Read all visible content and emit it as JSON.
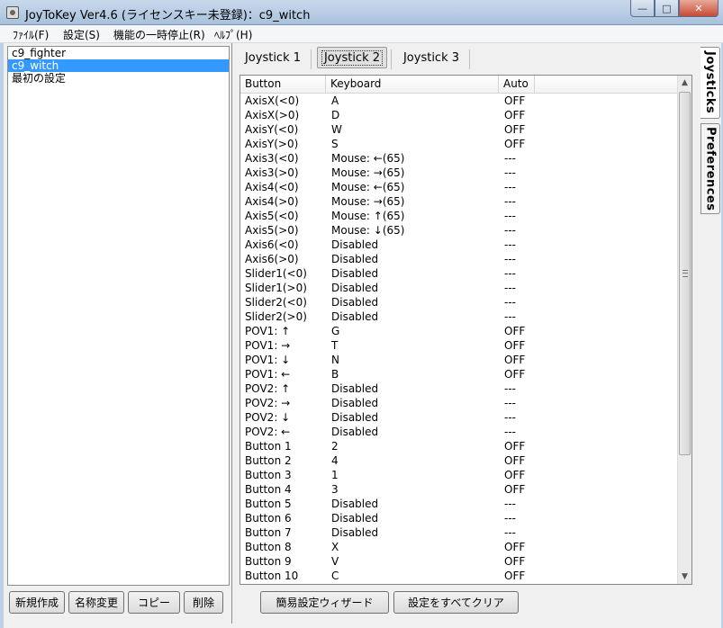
{
  "window": {
    "title": "JoyToKey Ver4.6 (ライセンスキー未登録)：c9_witch",
    "minimize": "—",
    "maximize": "□",
    "close": "✕"
  },
  "menu": [
    "ﾌｧｲﾙ(F)",
    "設定(S)",
    "機能の一時停止(R)",
    "ﾍﾙﾌﾟ(H)"
  ],
  "profiles": [
    {
      "label": "c9_fighter",
      "selected": false
    },
    {
      "label": "c9_witch",
      "selected": true
    },
    {
      "label": "最初の設定",
      "selected": false
    }
  ],
  "left_buttons": [
    "新規作成",
    "名称変更",
    "コピー",
    "削除"
  ],
  "tabs": [
    {
      "label": "Joystick 1",
      "active": false
    },
    {
      "label": "Joystick 2",
      "active": true
    },
    {
      "label": "Joystick 3",
      "active": false
    }
  ],
  "side_tabs": [
    {
      "label": "Joysticks",
      "active": true
    },
    {
      "label": "Preferences",
      "active": false
    }
  ],
  "grid": {
    "headers": [
      "Button",
      "Keyboard",
      "Auto"
    ],
    "rows": [
      [
        "AxisX(<0)",
        "A",
        "OFF"
      ],
      [
        "AxisX(>0)",
        "D",
        "OFF"
      ],
      [
        "AxisY(<0)",
        "W",
        "OFF"
      ],
      [
        "AxisY(>0)",
        "S",
        "OFF"
      ],
      [
        "Axis3(<0)",
        "Mouse: ←(65)",
        "---"
      ],
      [
        "Axis3(>0)",
        "Mouse: →(65)",
        "---"
      ],
      [
        "Axis4(<0)",
        "Mouse: ←(65)",
        "---"
      ],
      [
        "Axis4(>0)",
        "Mouse: →(65)",
        "---"
      ],
      [
        "Axis5(<0)",
        "Mouse: ↑(65)",
        "---"
      ],
      [
        "Axis5(>0)",
        "Mouse: ↓(65)",
        "---"
      ],
      [
        "Axis6(<0)",
        "Disabled",
        "---"
      ],
      [
        "Axis6(>0)",
        "Disabled",
        "---"
      ],
      [
        "Slider1(<0)",
        "Disabled",
        "---"
      ],
      [
        "Slider1(>0)",
        "Disabled",
        "---"
      ],
      [
        "Slider2(<0)",
        "Disabled",
        "---"
      ],
      [
        "Slider2(>0)",
        "Disabled",
        "---"
      ],
      [
        "POV1: ↑",
        "G",
        "OFF"
      ],
      [
        "POV1: →",
        "T",
        "OFF"
      ],
      [
        "POV1: ↓",
        "N",
        "OFF"
      ],
      [
        "POV1: ←",
        "B",
        "OFF"
      ],
      [
        "POV2: ↑",
        "Disabled",
        "---"
      ],
      [
        "POV2: →",
        "Disabled",
        "---"
      ],
      [
        "POV2: ↓",
        "Disabled",
        "---"
      ],
      [
        "POV2: ←",
        "Disabled",
        "---"
      ],
      [
        "Button 1",
        "2",
        "OFF"
      ],
      [
        "Button 2",
        "4",
        "OFF"
      ],
      [
        "Button 3",
        "1",
        "OFF"
      ],
      [
        "Button 4",
        "3",
        "OFF"
      ],
      [
        "Button 5",
        "Disabled",
        "---"
      ],
      [
        "Button 6",
        "Disabled",
        "---"
      ],
      [
        "Button 7",
        "Disabled",
        "---"
      ],
      [
        "Button 8",
        "X",
        "OFF"
      ],
      [
        "Button 9",
        "V",
        "OFF"
      ],
      [
        "Button 10",
        "C",
        "OFF"
      ]
    ]
  },
  "bottom_buttons": [
    "簡易設定ウィザード",
    "設定をすべてクリア"
  ],
  "icons": {
    "app": "joystick-icon",
    "scroll_up": "▲",
    "scroll_down": "▼"
  }
}
